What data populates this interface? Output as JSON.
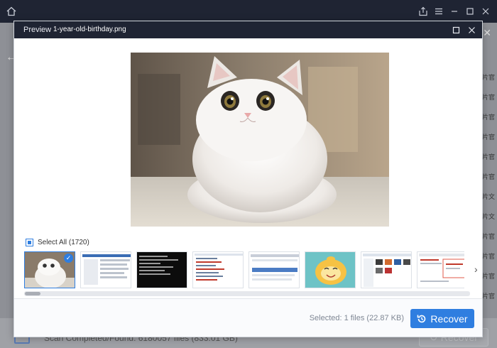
{
  "dialog": {
    "title": "Preview",
    "filename": "1-year-old-birthday.png",
    "select_all_label": "Select All (1720)",
    "selected_status": "Selected: 1 files (22.87 KB)",
    "recover_label": "Recover"
  },
  "background_app": {
    "scan_status": "Scan Completed/Found: 6180057 files (833.01 GB)",
    "recover_label": "Recover",
    "side_labels": [
      "片官",
      "片官",
      "片官",
      "片官",
      "片官",
      "片官",
      "片文",
      "片文",
      "片官",
      "片官",
      "片官",
      "片官"
    ]
  },
  "thumbnails": [
    {
      "name": "cat-photo",
      "selected": true
    },
    {
      "name": "dialog-screenshot",
      "selected": false
    },
    {
      "name": "terminal-screenshot",
      "selected": false
    },
    {
      "name": "file-list-screenshot",
      "selected": false
    },
    {
      "name": "window-screenshot",
      "selected": false
    },
    {
      "name": "cartoon-smiley",
      "selected": false
    },
    {
      "name": "explorer-screenshot",
      "selected": false
    },
    {
      "name": "error-dialog-screenshot",
      "selected": false
    }
  ],
  "colors": {
    "accent": "#2f7ee0",
    "header_bg": "#1f2433"
  },
  "icons": {
    "home": "home-icon",
    "share": "share-icon",
    "menu": "menu-icon",
    "minimize": "minimize-icon",
    "maximize": "maximize-icon",
    "close": "close-icon",
    "recover": "restore-icon",
    "next": "chevron-right-icon"
  }
}
